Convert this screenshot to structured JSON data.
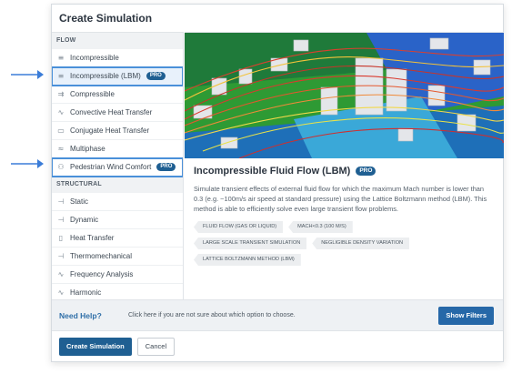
{
  "dialog": {
    "title": "Create Simulation"
  },
  "sidebar": {
    "sections": [
      {
        "label": "FLOW",
        "items": [
          {
            "label": "Incompressible",
            "icon": "incompressible-icon",
            "glyph": "≡",
            "pro": false
          },
          {
            "label": "Incompressible (LBM)",
            "icon": "lbm-icon",
            "glyph": "≡",
            "pro": true,
            "selected": true,
            "highlighted": true
          },
          {
            "label": "Compressible",
            "icon": "compressible-icon",
            "glyph": "⇉",
            "pro": false
          },
          {
            "label": "Convective Heat Transfer",
            "icon": "convective-heat-icon",
            "glyph": "∿",
            "pro": false
          },
          {
            "label": "Conjugate Heat Transfer",
            "icon": "conjugate-heat-icon",
            "glyph": "▭",
            "pro": false
          },
          {
            "label": "Multiphase",
            "icon": "multiphase-icon",
            "glyph": "≈",
            "pro": false
          },
          {
            "label": "Pedestrian Wind Comfort",
            "icon": "pedestrian-wind-icon",
            "glyph": "⚇",
            "pro": true,
            "highlighted": true
          }
        ]
      },
      {
        "label": "STRUCTURAL",
        "items": [
          {
            "label": "Static",
            "icon": "static-icon",
            "glyph": "⊣",
            "pro": false
          },
          {
            "label": "Dynamic",
            "icon": "dynamic-icon",
            "glyph": "⊣",
            "pro": false
          },
          {
            "label": "Heat Transfer",
            "icon": "thermometer-icon",
            "glyph": "▯",
            "pro": false
          },
          {
            "label": "Thermomechanical",
            "icon": "thermomechanical-icon",
            "glyph": "⊣",
            "pro": false
          },
          {
            "label": "Frequency Analysis",
            "icon": "frequency-icon",
            "glyph": "∿",
            "pro": false
          },
          {
            "label": "Harmonic",
            "icon": "harmonic-icon",
            "glyph": "∿",
            "pro": false
          }
        ]
      }
    ],
    "pro_label": "PRO"
  },
  "detail": {
    "title": "Incompressible Fluid Flow (LBM)",
    "pro_label": "PRO",
    "description": "Simulate transient effects of external fluid flow for which the maximum Mach number is lower than 0.3 (e.g. ~100m/s air speed at standard pressure) using the Lattice Boltzmann method (LBM). This method is able to efficiently solve even large transient flow problems.",
    "tags": [
      "FLUID FLOW (GAS OR LIQUID)",
      "MACH<0.3 (100 M/S)",
      "LARGE SCALE TRANSIENT SIMULATION",
      "NEGLIGIBLE DENSITY VARIATION",
      "LATTICE BOLTZMANN METHOD (LBM)"
    ]
  },
  "help": {
    "label": "Need Help?",
    "text": "Click here if you are not sure about which option to choose.",
    "button": "Show Filters"
  },
  "footer": {
    "create": "Create Simulation",
    "cancel": "Cancel"
  },
  "colors": {
    "accent": "#1f5f92",
    "highlight": "#4a90d9",
    "help": "#2f6fa8"
  }
}
